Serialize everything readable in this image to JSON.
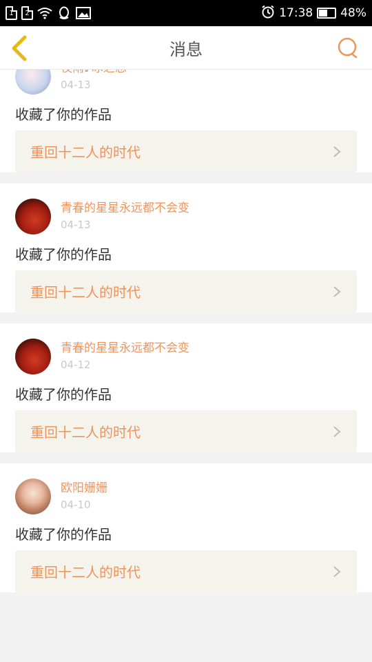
{
  "status_bar": {
    "sim1": "1",
    "sim2": "2",
    "time": "17:38",
    "battery": "48%",
    "battery_level": 0.48
  },
  "header": {
    "title": "消息",
    "back_icon": "chevron-left-icon",
    "search_icon": "search-icon",
    "accent_color": "#f0935a",
    "back_color": "#e8b81a"
  },
  "messages": [
    {
      "name": "夜雨♪冰之恋",
      "date": "04-13",
      "action": "收藏了你的作品",
      "work": "重回十二人的时代"
    },
    {
      "name": "青春的星星永远都不会变",
      "date": "04-13",
      "action": "收藏了你的作品",
      "work": "重回十二人的时代"
    },
    {
      "name": "青春的星星永远都不会变",
      "date": "04-12",
      "action": "收藏了你的作品",
      "work": "重回十二人的时代"
    },
    {
      "name": "欧阳姗姗",
      "date": "04-10",
      "action": "收藏了你的作品",
      "work": "重回十二人的时代"
    }
  ]
}
